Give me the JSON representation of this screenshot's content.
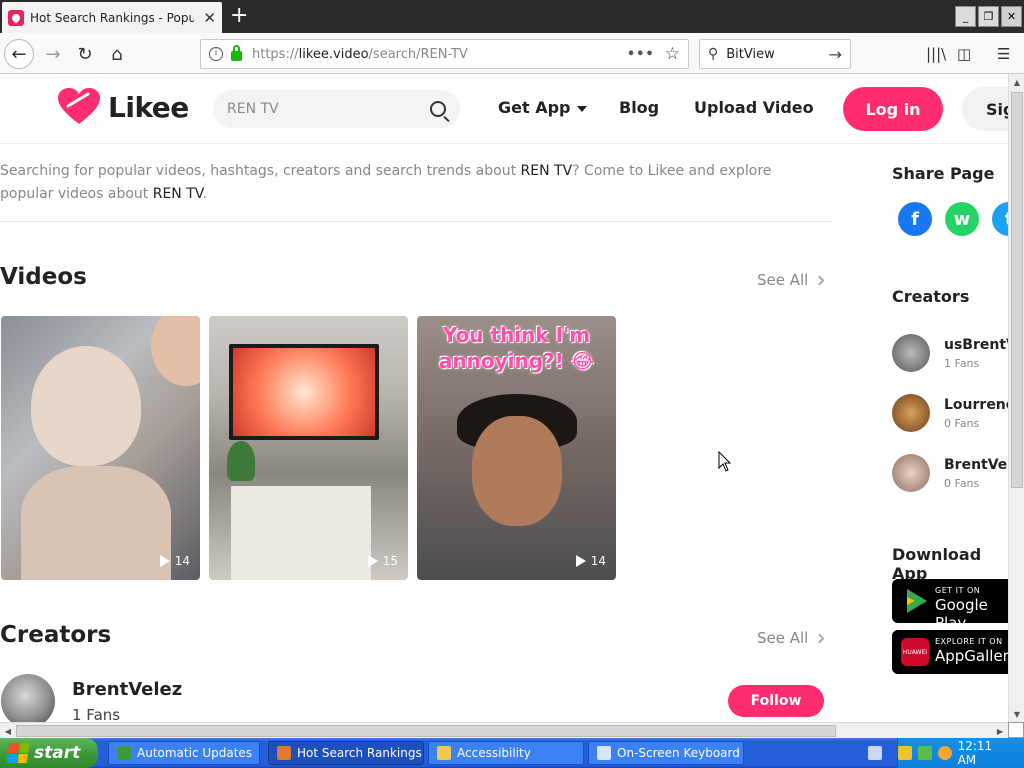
{
  "browser": {
    "tab_title": "Hot Search Rankings - Popular and",
    "url_prefix": "https://",
    "url_domain": "likee.video",
    "url_path": "/search/REN-TV",
    "search_engine": "BitView",
    "window_buttons": [
      "_",
      "❐",
      "✕"
    ]
  },
  "site": {
    "logo_text": "Likee",
    "search_value": "REN TV",
    "nav": {
      "get_app": "Get App",
      "blog": "Blog",
      "upload": "Upload Video",
      "login": "Log in",
      "signup": "Sig"
    },
    "brand_color": "#ff2d6e"
  },
  "intro": {
    "part1": "Searching for popular videos, hashtags, creators and search trends about ",
    "term1": "REN TV",
    "part2": "? Come to Likee and explore popular videos about ",
    "term2": "REN TV",
    "part3": "."
  },
  "videos": {
    "title": "Videos",
    "see_all": "See All",
    "items": [
      {
        "plays": "14"
      },
      {
        "plays": "15"
      },
      {
        "plays": "14",
        "caption_line1": "You think I'm",
        "caption_line2": "annoying?! 😂"
      }
    ]
  },
  "creators": {
    "title": "Creators",
    "see_all": "See All",
    "items": [
      {
        "name": "BrentVelez",
        "fans": "1 Fans",
        "follow": "Follow"
      }
    ]
  },
  "sidebar": {
    "share_title": "Share Page",
    "share": [
      "f",
      "w",
      "t"
    ],
    "creators_title": "Creators",
    "creators": [
      {
        "name": "usBrentVe",
        "fans": "1 Fans"
      },
      {
        "name": "Lourrence",
        "fans": "0 Fans"
      },
      {
        "name": "BrentVele",
        "fans": "0 Fans"
      }
    ],
    "download_title": "Download App",
    "google": {
      "small": "GET IT ON",
      "big": "Google Play"
    },
    "huawei": {
      "small": "EXPLORE IT ON",
      "big": "AppGallery",
      "icon": "HUAWEI"
    }
  },
  "taskbar": {
    "start": "start",
    "tasks": [
      "Automatic Updates",
      "Hot Search Rankings ...",
      "Accessibility",
      "On-Screen Keyboard"
    ],
    "clock": "12:11 AM"
  }
}
